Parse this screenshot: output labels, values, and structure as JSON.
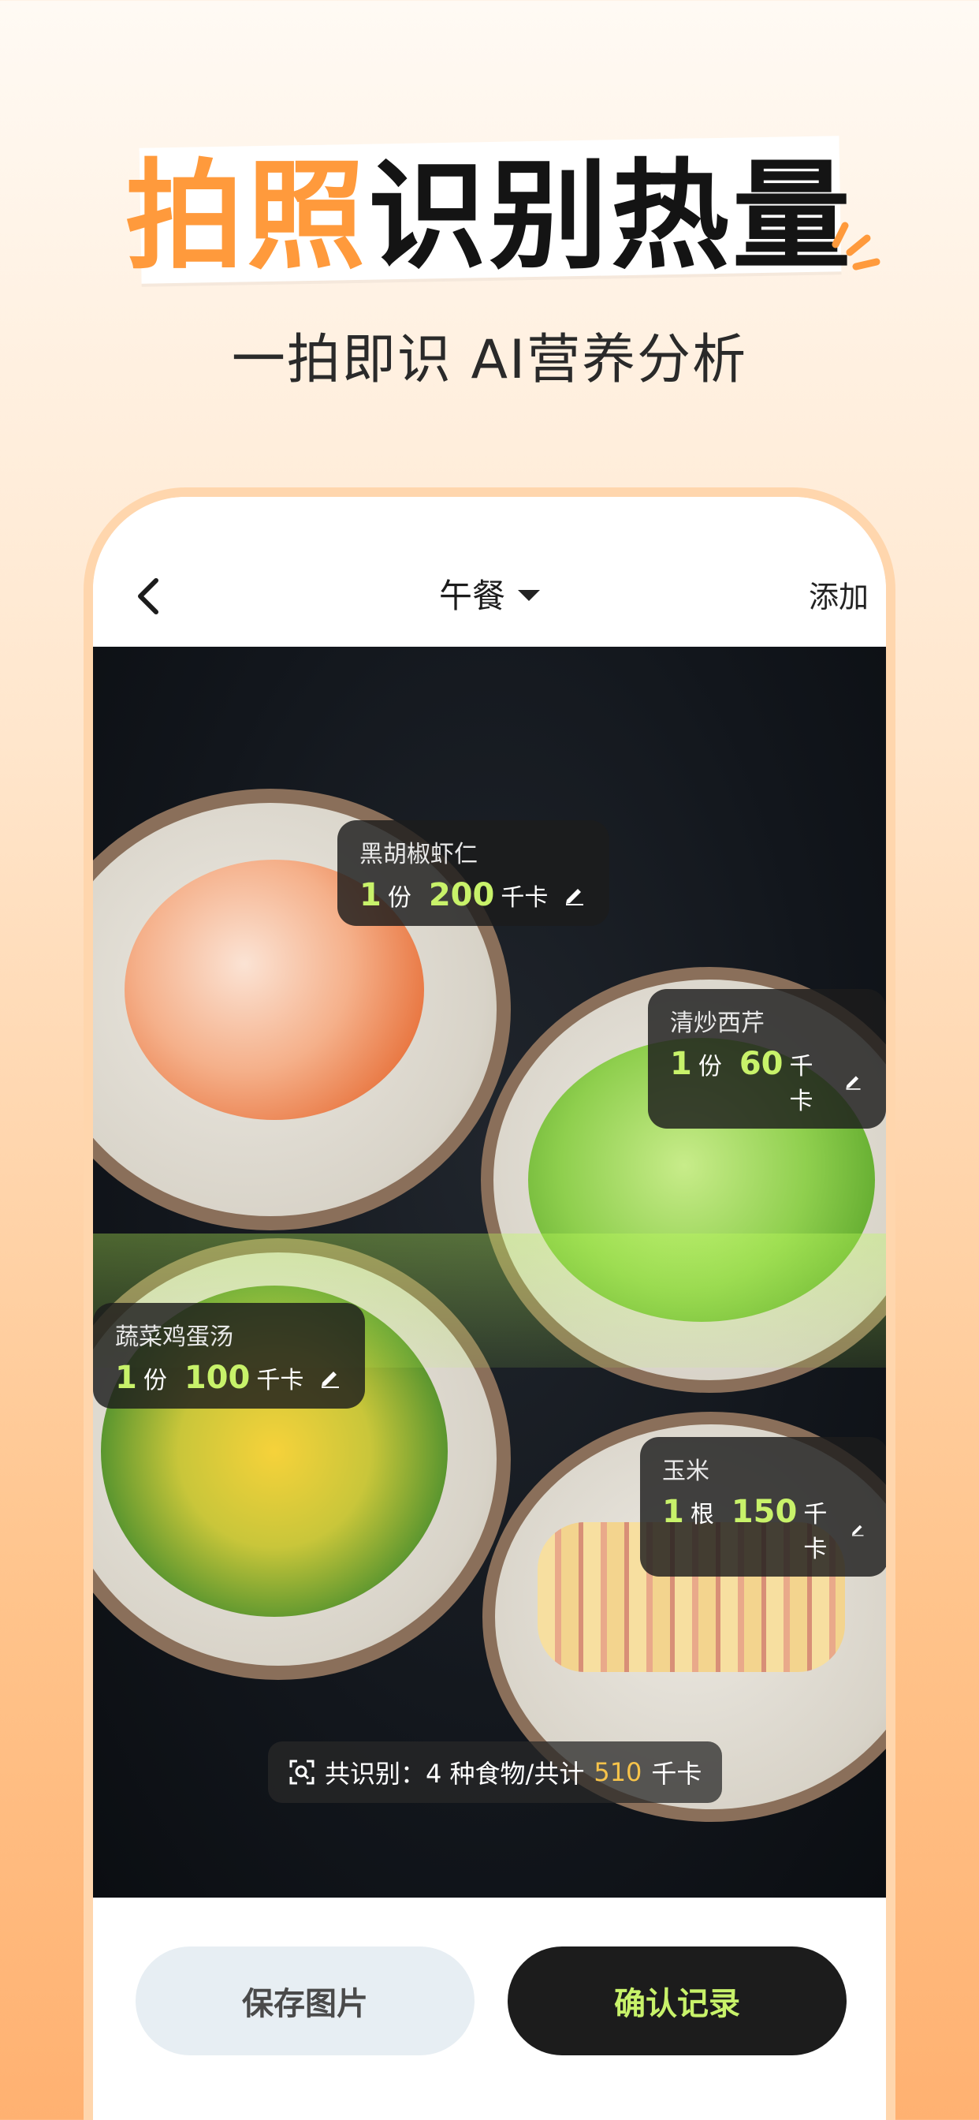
{
  "hero": {
    "title_highlight": "拍照",
    "title_rest": "识别热量",
    "subtitle": "一拍即识 AI营养分析"
  },
  "nav": {
    "meal": "午餐",
    "add": "添加"
  },
  "foods": [
    {
      "name": "黑胡椒虾仁",
      "qty": "1",
      "unit": "份",
      "kcal": "200",
      "kcal_unit": "千卡"
    },
    {
      "name": "清炒西芹",
      "qty": "1",
      "unit": "份",
      "kcal": "60",
      "kcal_unit": "千卡"
    },
    {
      "name": "蔬菜鸡蛋汤",
      "qty": "1",
      "unit": "份",
      "kcal": "100",
      "kcal_unit": "千卡"
    },
    {
      "name": "玉米",
      "qty": "1",
      "unit": "根",
      "kcal": "150",
      "kcal_unit": "千卡"
    }
  ],
  "summary": {
    "prefix": "共识别：4 种食物/共计",
    "total": "510",
    "unit": "千卡"
  },
  "buttons": {
    "save": "保存图片",
    "confirm": "确认记录"
  },
  "colors": {
    "accent_orange": "#ff9a3c",
    "accent_green": "#c8f26a",
    "summary_yellow": "#f7c34a"
  }
}
